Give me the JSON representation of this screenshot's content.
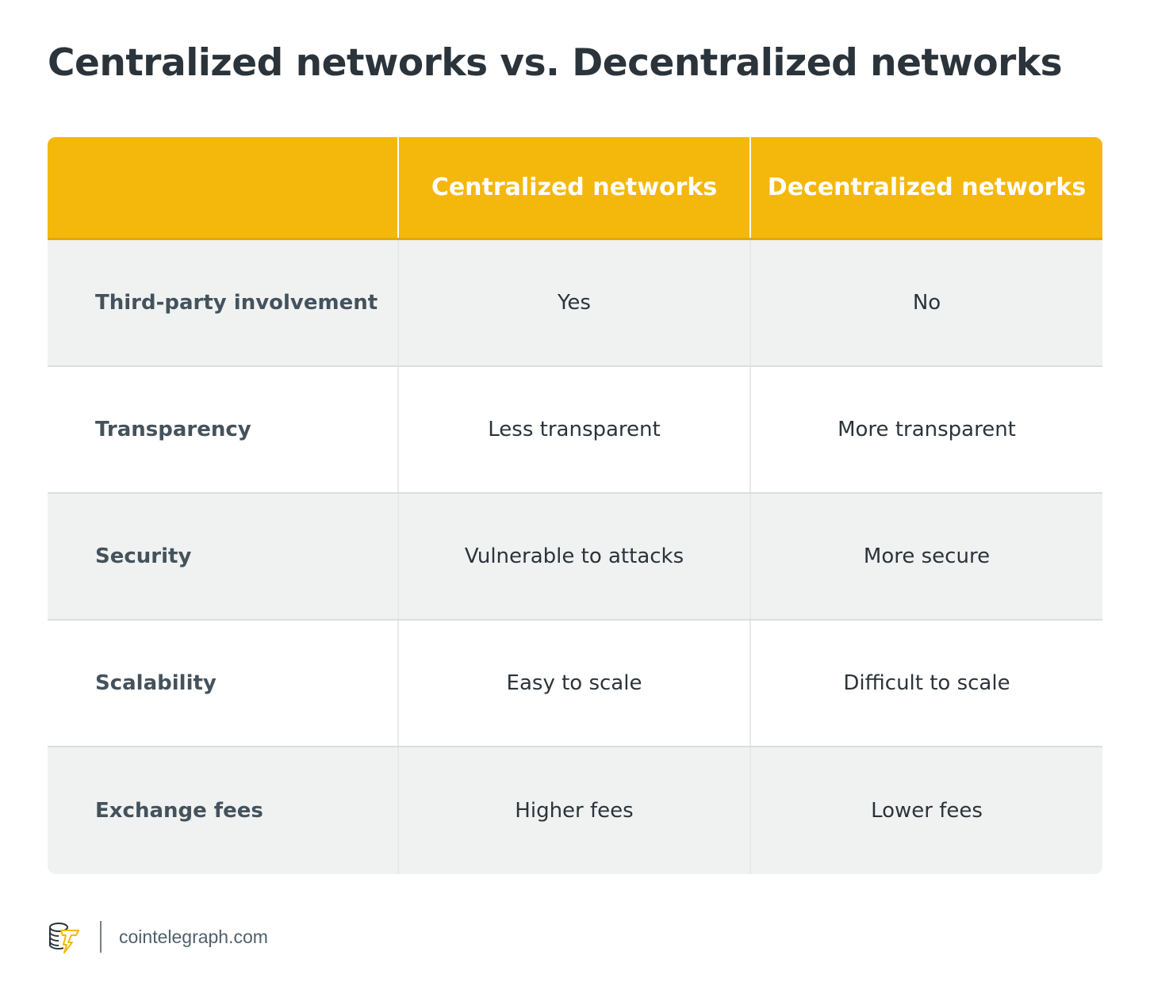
{
  "title": "Centralized networks vs. Decentralized networks",
  "table": {
    "headers": [
      "",
      "Centralized networks",
      "Decentralized networks"
    ],
    "rows": [
      {
        "label": "Third-party involvement",
        "centralized": "Yes",
        "decentralized": "No"
      },
      {
        "label": "Transparency",
        "centralized": "Less transparent",
        "decentralized": "More transparent"
      },
      {
        "label": "Security",
        "centralized": "Vulnerable to attacks",
        "decentralized": "More secure"
      },
      {
        "label": "Scalability",
        "centralized": "Easy to scale",
        "decentralized": "Difficult to scale"
      },
      {
        "label": "Exchange fees",
        "centralized": "Higher fees",
        "decentralized": "Lower fees"
      }
    ]
  },
  "footer": {
    "logo_icon": "cointelegraph-logo-icon",
    "site": "cointelegraph.com"
  },
  "colors": {
    "header_bg": "#f4b70b",
    "title": "#2b343b",
    "row_label": "#44525c",
    "row_alt_bg": "#f0f2f2"
  }
}
